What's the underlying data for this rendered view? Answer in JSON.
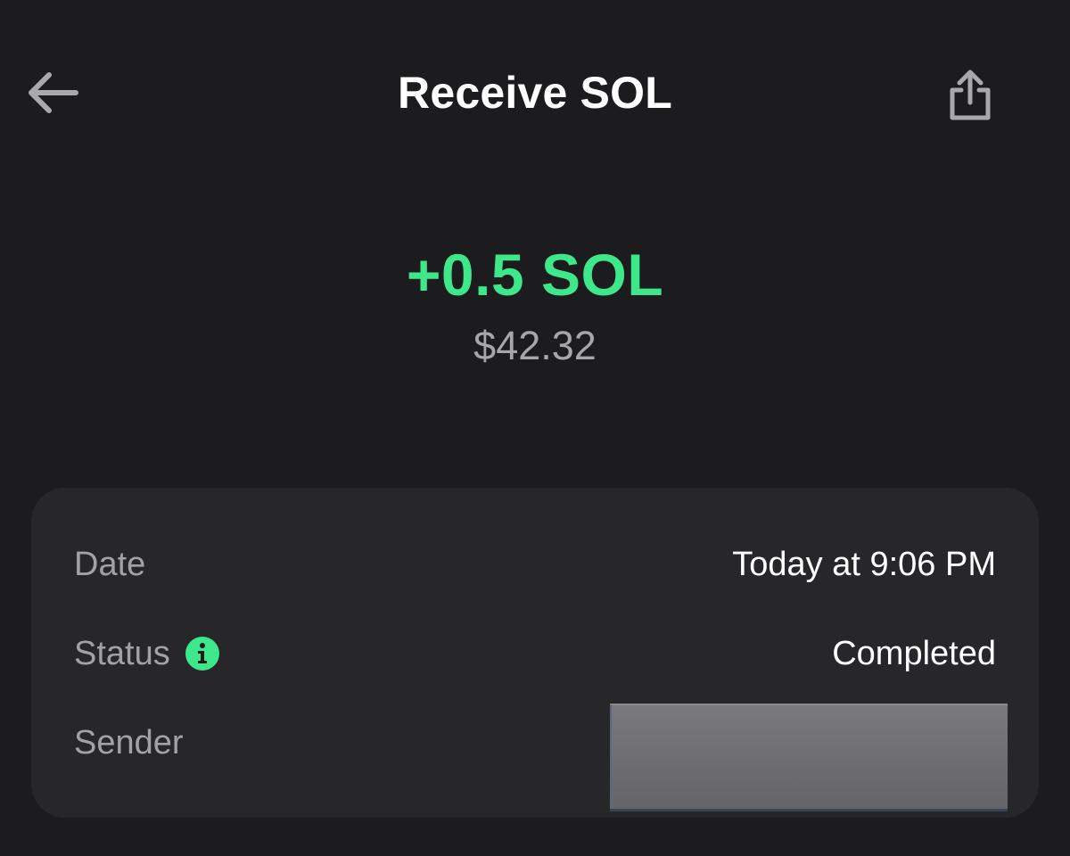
{
  "header": {
    "title": "Receive SOL",
    "back_icon": "arrow-left-icon",
    "share_icon": "share-icon"
  },
  "amount": {
    "crypto": "+0.5 SOL",
    "fiat": "$42.32",
    "color": "#3ee88a"
  },
  "details": {
    "date_label": "Date",
    "date_value": "Today at 9:06 PM",
    "status_label": "Status",
    "status_value": "Completed",
    "status_info_icon": "info-icon",
    "sender_label": "Sender"
  },
  "colors": {
    "background": "#1c1c1e",
    "card": "#27272a",
    "accent": "#3ee88a",
    "muted_text": "#a2a2a6"
  }
}
